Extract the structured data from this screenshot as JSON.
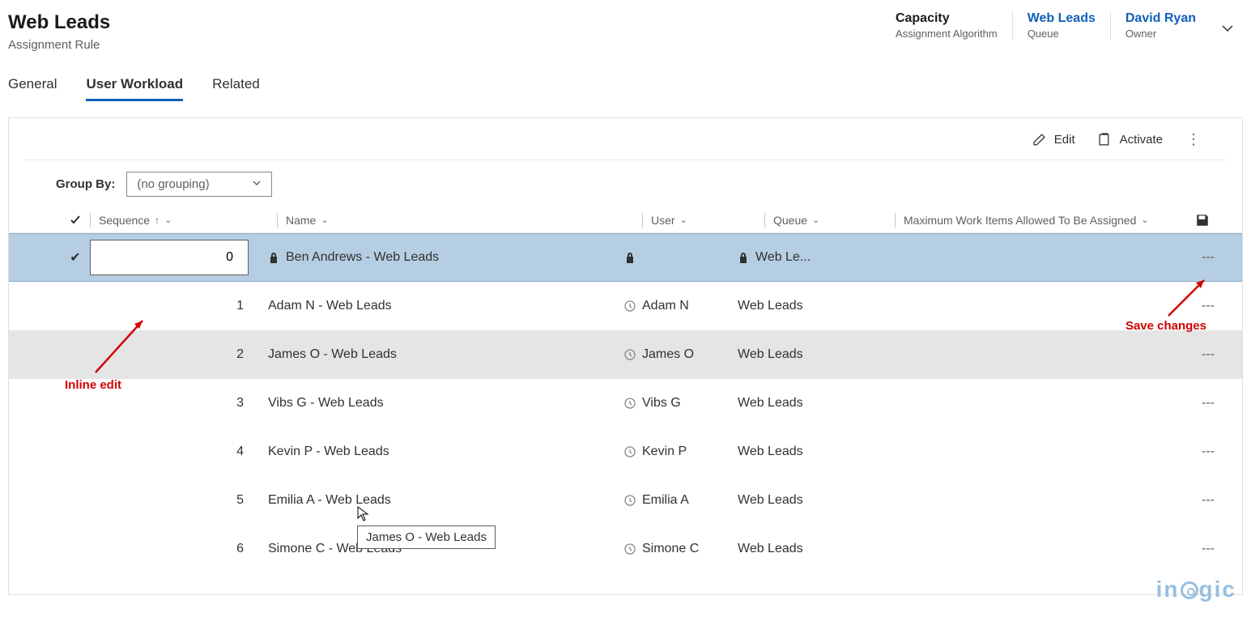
{
  "header": {
    "title": "Web Leads",
    "subtitle": "Assignment Rule",
    "fields": [
      {
        "value": "Capacity",
        "label": "Assignment Algorithm",
        "link": false
      },
      {
        "value": "Web Leads",
        "label": "Queue",
        "link": true
      },
      {
        "value": "David Ryan",
        "label": "Owner",
        "link": true
      }
    ]
  },
  "tabs": [
    {
      "label": "General",
      "active": false
    },
    {
      "label": "User Workload",
      "active": true
    },
    {
      "label": "Related",
      "active": false
    }
  ],
  "toolbar": {
    "edit": "Edit",
    "activate": "Activate"
  },
  "groupby": {
    "label": "Group By:",
    "value": "(no grouping)"
  },
  "columns": {
    "sequence": "Sequence",
    "name": "Name",
    "user": "User",
    "queue": "Queue",
    "max": "Maximum Work Items Allowed To Be Assigned"
  },
  "edit_row": {
    "seq_input": "0",
    "name": "Ben Andrews - Web Leads",
    "queue": "Web Le...",
    "max": "---"
  },
  "rows": [
    {
      "seq": "1",
      "name": "Adam N - Web Leads",
      "user": "Adam N",
      "queue": "Web Leads",
      "max": "---",
      "hover": false
    },
    {
      "seq": "2",
      "name": "James O - Web Leads",
      "user": "James O",
      "queue": "Web Leads",
      "max": "---",
      "hover": true
    },
    {
      "seq": "3",
      "name": "Vibs G - Web Leads",
      "user": "Vibs G",
      "queue": "Web Leads",
      "max": "---",
      "hover": false
    },
    {
      "seq": "4",
      "name": "Kevin P - Web Leads",
      "user": "Kevin P",
      "queue": "Web Leads",
      "max": "---",
      "hover": false
    },
    {
      "seq": "5",
      "name": "Emilia A - Web Leads",
      "user": "Emilia A",
      "queue": "Web Leads",
      "max": "---",
      "hover": false
    },
    {
      "seq": "6",
      "name": "Simone C - Web Leads",
      "user": "Simone C",
      "queue": "Web Leads",
      "max": "---",
      "hover": false
    }
  ],
  "tooltip": "James O - Web Leads",
  "annotations": {
    "inline_edit": "Inline edit",
    "save_changes": "Save changes"
  },
  "watermark": "in gic"
}
